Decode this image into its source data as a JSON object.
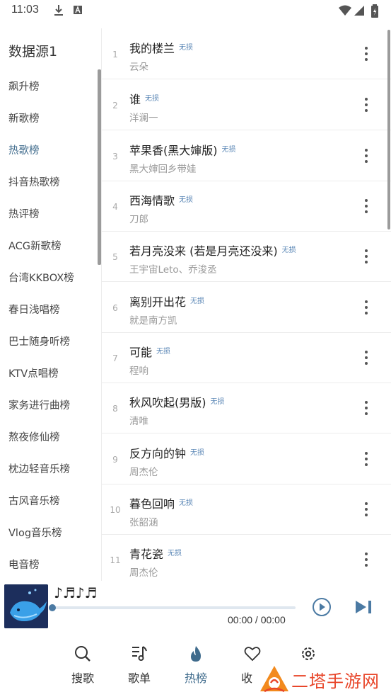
{
  "status": {
    "time": "11:03"
  },
  "sidebar": {
    "title": "数据源1",
    "items": [
      {
        "label": "飙升榜",
        "active": false
      },
      {
        "label": "新歌榜",
        "active": false
      },
      {
        "label": "热歌榜",
        "active": true
      },
      {
        "label": "抖音热歌榜",
        "active": false
      },
      {
        "label": "热评榜",
        "active": false
      },
      {
        "label": "ACG新歌榜",
        "active": false
      },
      {
        "label": "台湾KKBOX榜",
        "active": false
      },
      {
        "label": "春日浅唱榜",
        "active": false
      },
      {
        "label": "巴士随身听榜",
        "active": false
      },
      {
        "label": "KTV点唱榜",
        "active": false
      },
      {
        "label": "家务进行曲榜",
        "active": false
      },
      {
        "label": "熬夜修仙榜",
        "active": false
      },
      {
        "label": "枕边轻音乐榜",
        "active": false
      },
      {
        "label": "古风音乐榜",
        "active": false
      },
      {
        "label": "Vlog音乐榜",
        "active": false
      },
      {
        "label": "电音榜",
        "active": false
      }
    ]
  },
  "songs": [
    {
      "num": "1",
      "title": "我的楼兰",
      "badge": "无损",
      "artist": "云朵"
    },
    {
      "num": "2",
      "title": "谁",
      "badge": "无损",
      "artist": "洋澜一"
    },
    {
      "num": "3",
      "title": "苹果香(黑大婶版)",
      "badge": "无损",
      "artist": "黑大婶回乡带娃"
    },
    {
      "num": "4",
      "title": "西海情歌",
      "badge": "无损",
      "artist": "刀郎"
    },
    {
      "num": "5",
      "title": "若月亮没来 (若是月亮还没来)",
      "badge": "无损",
      "artist": "王宇宙Leto、乔浚丞"
    },
    {
      "num": "6",
      "title": "离别开出花",
      "badge": "无损",
      "artist": "就是南方凯"
    },
    {
      "num": "7",
      "title": "可能",
      "badge": "无损",
      "artist": "程响"
    },
    {
      "num": "8",
      "title": "秋风吹起(男版)",
      "badge": "无损",
      "artist": "清唯"
    },
    {
      "num": "9",
      "title": "反方向的钟",
      "badge": "无损",
      "artist": "周杰伦"
    },
    {
      "num": "10",
      "title": "暮色回响",
      "badge": "无损",
      "artist": "张韶涵"
    },
    {
      "num": "11",
      "title": "青花瓷",
      "badge": "无损",
      "artist": "周杰伦"
    }
  ],
  "player": {
    "title": "♪♬♪♬",
    "time": "00:00 / 00:00",
    "progress": 0
  },
  "nav": {
    "items": [
      {
        "label": "搜歌",
        "icon": "search-icon"
      },
      {
        "label": "歌单",
        "icon": "playlist-icon"
      },
      {
        "label": "热榜",
        "icon": "flame-icon",
        "active": true
      },
      {
        "label": "收",
        "icon": "heart-icon"
      },
      {
        "label": "",
        "icon": "gear-icon"
      }
    ]
  },
  "watermark": {
    "text": "二塔手游网"
  },
  "colors": {
    "accent": "#3f6b8c",
    "badge": "#5b87b6",
    "watermark": "#e8462a"
  }
}
